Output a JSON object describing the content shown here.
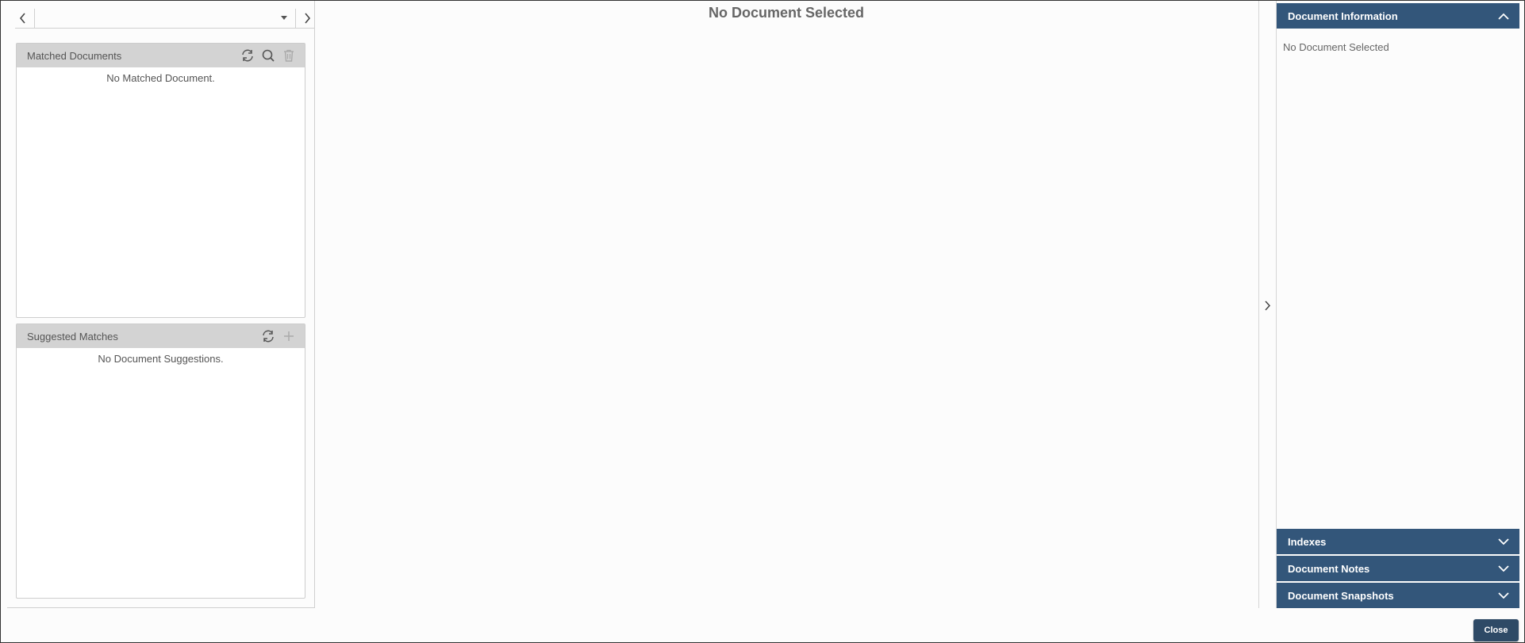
{
  "center": {
    "title": "No Document Selected"
  },
  "left": {
    "nav": {
      "prev_icon": "chevron-left-icon",
      "next_icon": "chevron-right-icon",
      "selected_value": ""
    },
    "matched": {
      "title": "Matched Documents",
      "empty_text": "No Matched Document.",
      "tools": [
        "refresh-icon",
        "search-icon",
        "trash-icon"
      ]
    },
    "suggested": {
      "title": "Suggested Matches",
      "empty_text": "No Document Suggestions.",
      "tools": [
        "refresh-icon",
        "plus-icon"
      ]
    }
  },
  "right": {
    "info": {
      "title": "Document Information",
      "body": "No Document Selected"
    },
    "indexes": {
      "title": "Indexes"
    },
    "notes": {
      "title": "Document Notes"
    },
    "snapshots": {
      "title": "Document Snapshots"
    }
  },
  "footer": {
    "close_label": "Close"
  },
  "colors": {
    "accent": "#33567a",
    "close_button": "#2e4a66",
    "section_header": "#d3d3d3"
  }
}
